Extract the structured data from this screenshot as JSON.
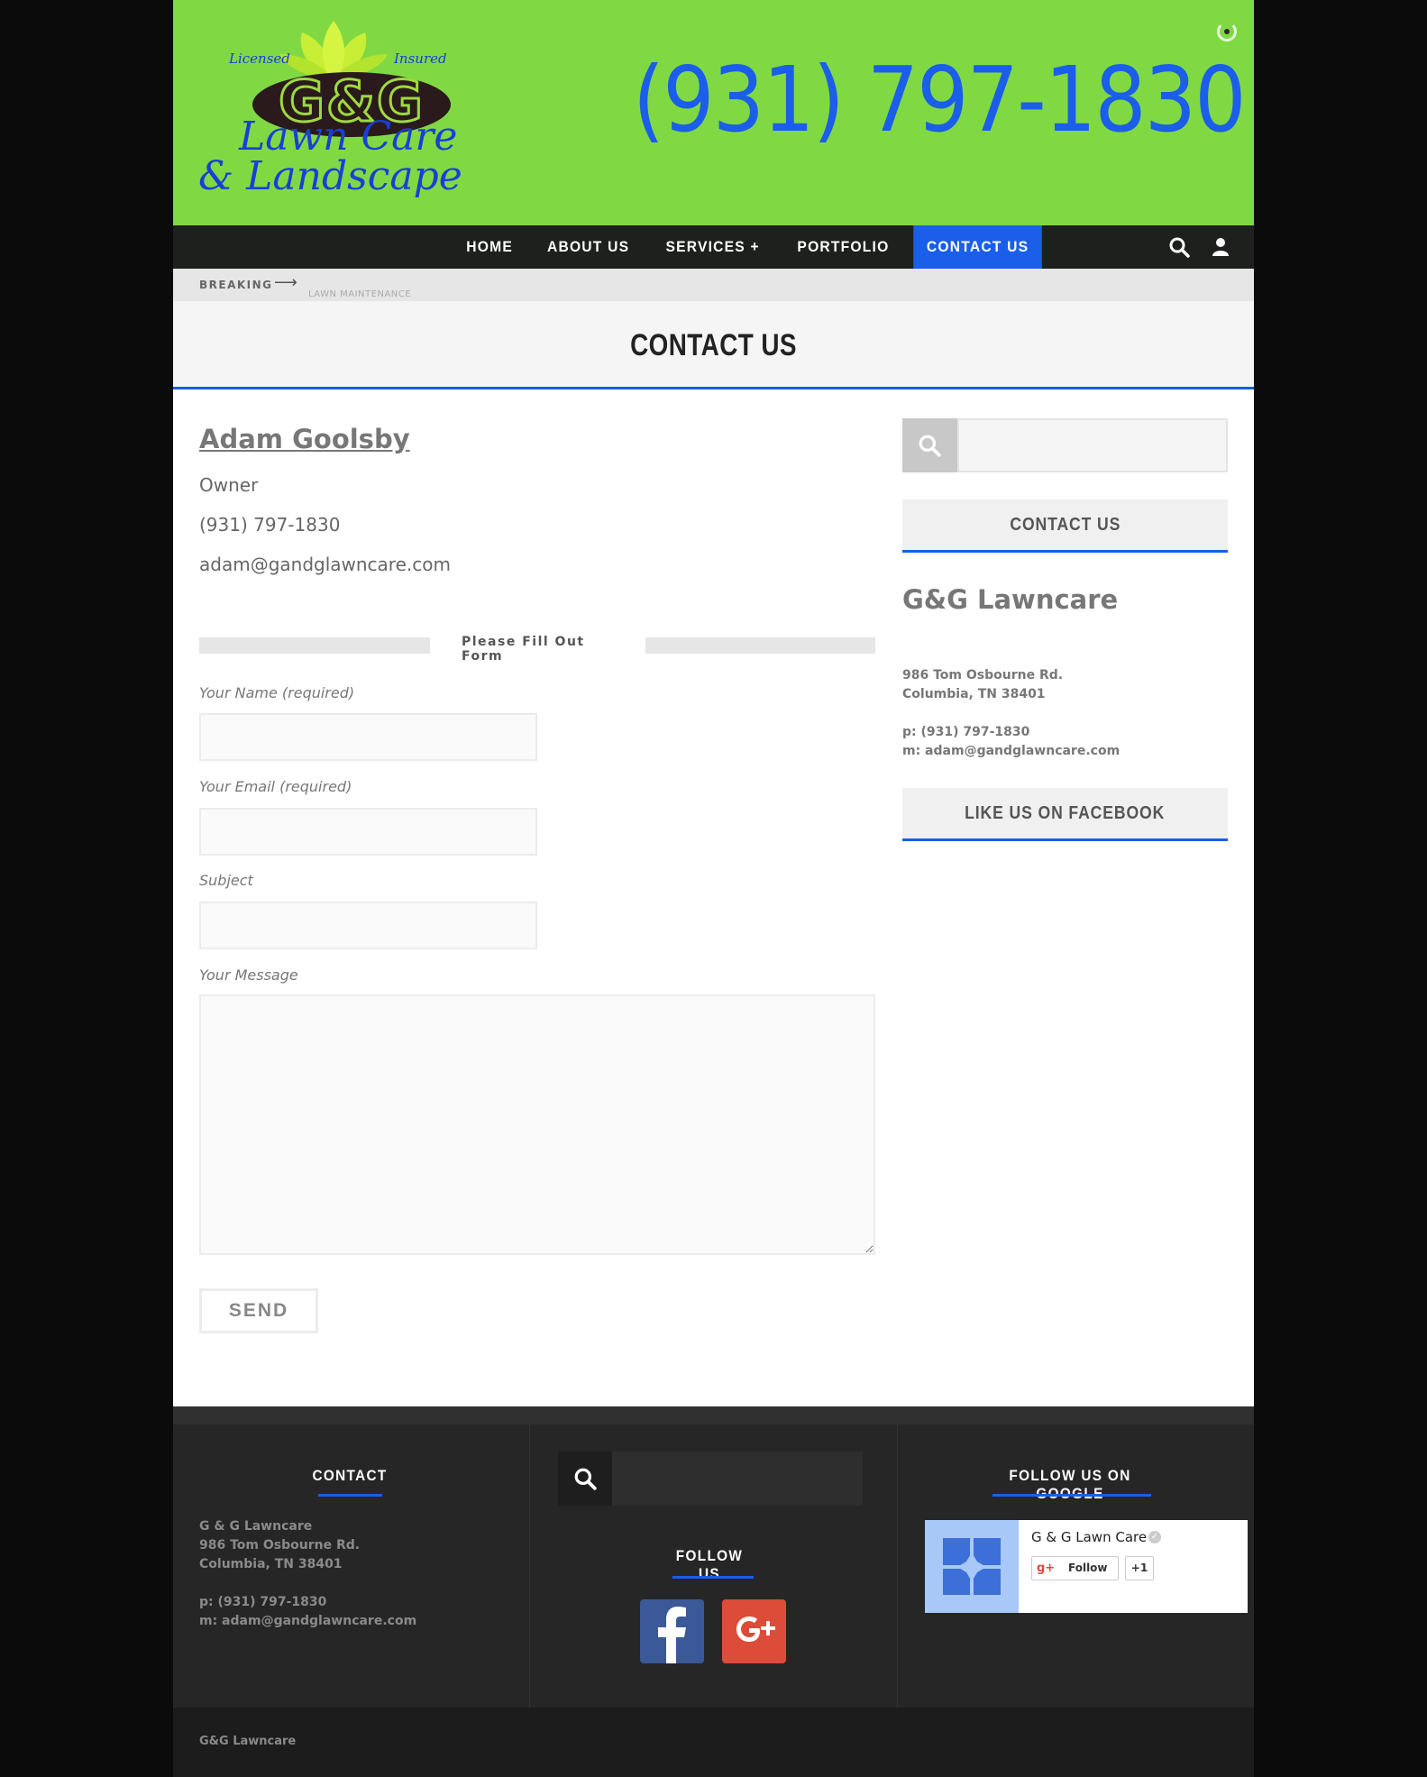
{
  "header": {
    "logo": {
      "licensed": "Licensed",
      "insured": "Insured",
      "brand": "G&G",
      "line1": "Lawn Care",
      "line2": "& Landscape"
    },
    "phone": "(931) 797-1830"
  },
  "nav": {
    "items": [
      {
        "label": "HOME"
      },
      {
        "label": "ABOUT US"
      },
      {
        "label": "SERVICES +"
      },
      {
        "label": "PORTFOLIO"
      },
      {
        "label": "CONTACT US"
      }
    ],
    "active_index": 4
  },
  "breaking": {
    "label": "BREAKING",
    "headline": "LAWN MAINTENANCE"
  },
  "page_title": "CONTACT US",
  "contact": {
    "name": "Adam Goolsby",
    "role": "Owner",
    "phone": "(931) 797-1830",
    "email": "adam@gandglawncare.com"
  },
  "form": {
    "heading": "Please Fill Out Form",
    "name_label": "Your Name (required)",
    "email_label": "Your Email (required)",
    "subject_label": "Subject",
    "message_label": "Your Message",
    "send_label": "SEND"
  },
  "sidebar": {
    "contact_title": "CONTACT US",
    "company": "G&G Lawncare",
    "address1": "986 Tom Osbourne Rd.",
    "address2": "Columbia, TN 38401",
    "phone": "p: (931) 797-1830",
    "email": "m: adam@gandglawncare.com",
    "facebook_title": "LIKE US ON FACEBOOK"
  },
  "footer": {
    "contact_title": "CONTACT",
    "company": "G & G Lawncare",
    "address1": "986 Tom Osbourne Rd.",
    "address2": "Columbia, TN 38401",
    "phone": "p: (931) 797-1830",
    "email": "m: adam@gandglawncare.com",
    "follow_title": "FOLLOW US",
    "google_title": "FOLLOW US ON GOOGLE",
    "google_card": {
      "name": "G & G Lawn Care",
      "follow_label": "Follow",
      "plus_one_label": "+1"
    },
    "copyright": "G&G Lawncare"
  },
  "colors": {
    "header_green": "#80d943",
    "accent_blue": "#1a5ee9",
    "nav_dark": "#1e201d",
    "footer_dark": "#262626"
  },
  "icons": {
    "search": "search-icon",
    "user": "user-icon",
    "arrow": "arrow-right-icon",
    "facebook": "facebook-icon",
    "google_plus": "google-plus-icon"
  }
}
